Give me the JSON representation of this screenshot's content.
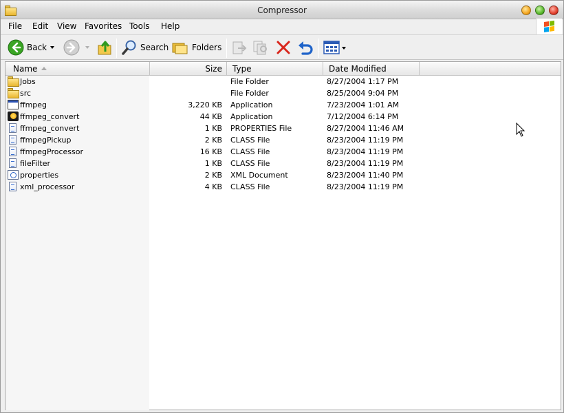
{
  "window": {
    "title": "Compressor"
  },
  "menu": [
    "File",
    "Edit",
    "View",
    "Favorites",
    "Tools",
    "Help"
  ],
  "toolbar": {
    "back_label": "Back",
    "search_label": "Search",
    "folders_label": "Folders"
  },
  "columns": {
    "name": "Name",
    "size": "Size",
    "type": "Type",
    "date": "Date Modified"
  },
  "files": [
    {
      "name": "Jobs",
      "size": "",
      "type": "File Folder",
      "date": "8/27/2004 1:17 PM",
      "icon": "folder-icon"
    },
    {
      "name": "src",
      "size": "",
      "type": "File Folder",
      "date": "8/25/2004 9:04 PM",
      "icon": "folder-icon"
    },
    {
      "name": "ffmpeg",
      "size": "3,220 KB",
      "type": "Application",
      "date": "7/23/2004 1:01 AM",
      "icon": "application-icon"
    },
    {
      "name": "ffmpeg_convert",
      "size": "44 KB",
      "type": "Application",
      "date": "7/12/2004 6:14 PM",
      "icon": "sun-application-icon"
    },
    {
      "name": "ffmpeg_convert",
      "size": "1 KB",
      "type": "PROPERTIES File",
      "date": "8/27/2004 11:46 AM",
      "icon": "document-icon"
    },
    {
      "name": "ffmpegPickup",
      "size": "2 KB",
      "type": "CLASS File",
      "date": "8/23/2004 11:19 PM",
      "icon": "document-icon"
    },
    {
      "name": "ffmpegProcessor",
      "size": "16 KB",
      "type": "CLASS File",
      "date": "8/23/2004 11:19 PM",
      "icon": "document-icon"
    },
    {
      "name": "fileFilter",
      "size": "1 KB",
      "type": "CLASS File",
      "date": "8/23/2004 11:19 PM",
      "icon": "document-icon"
    },
    {
      "name": "properties",
      "size": "2 KB",
      "type": "XML Document",
      "date": "8/23/2004 11:40 PM",
      "icon": "xml-document-icon"
    },
    {
      "name": "xml_processor",
      "size": "4 KB",
      "type": "CLASS File",
      "date": "8/23/2004 11:19 PM",
      "icon": "document-icon"
    }
  ],
  "colors": {
    "back_green": "#3aa524",
    "delete_red": "#d9261c",
    "undo_blue": "#1f63c9",
    "folder_yellow": "#f0c23a"
  }
}
